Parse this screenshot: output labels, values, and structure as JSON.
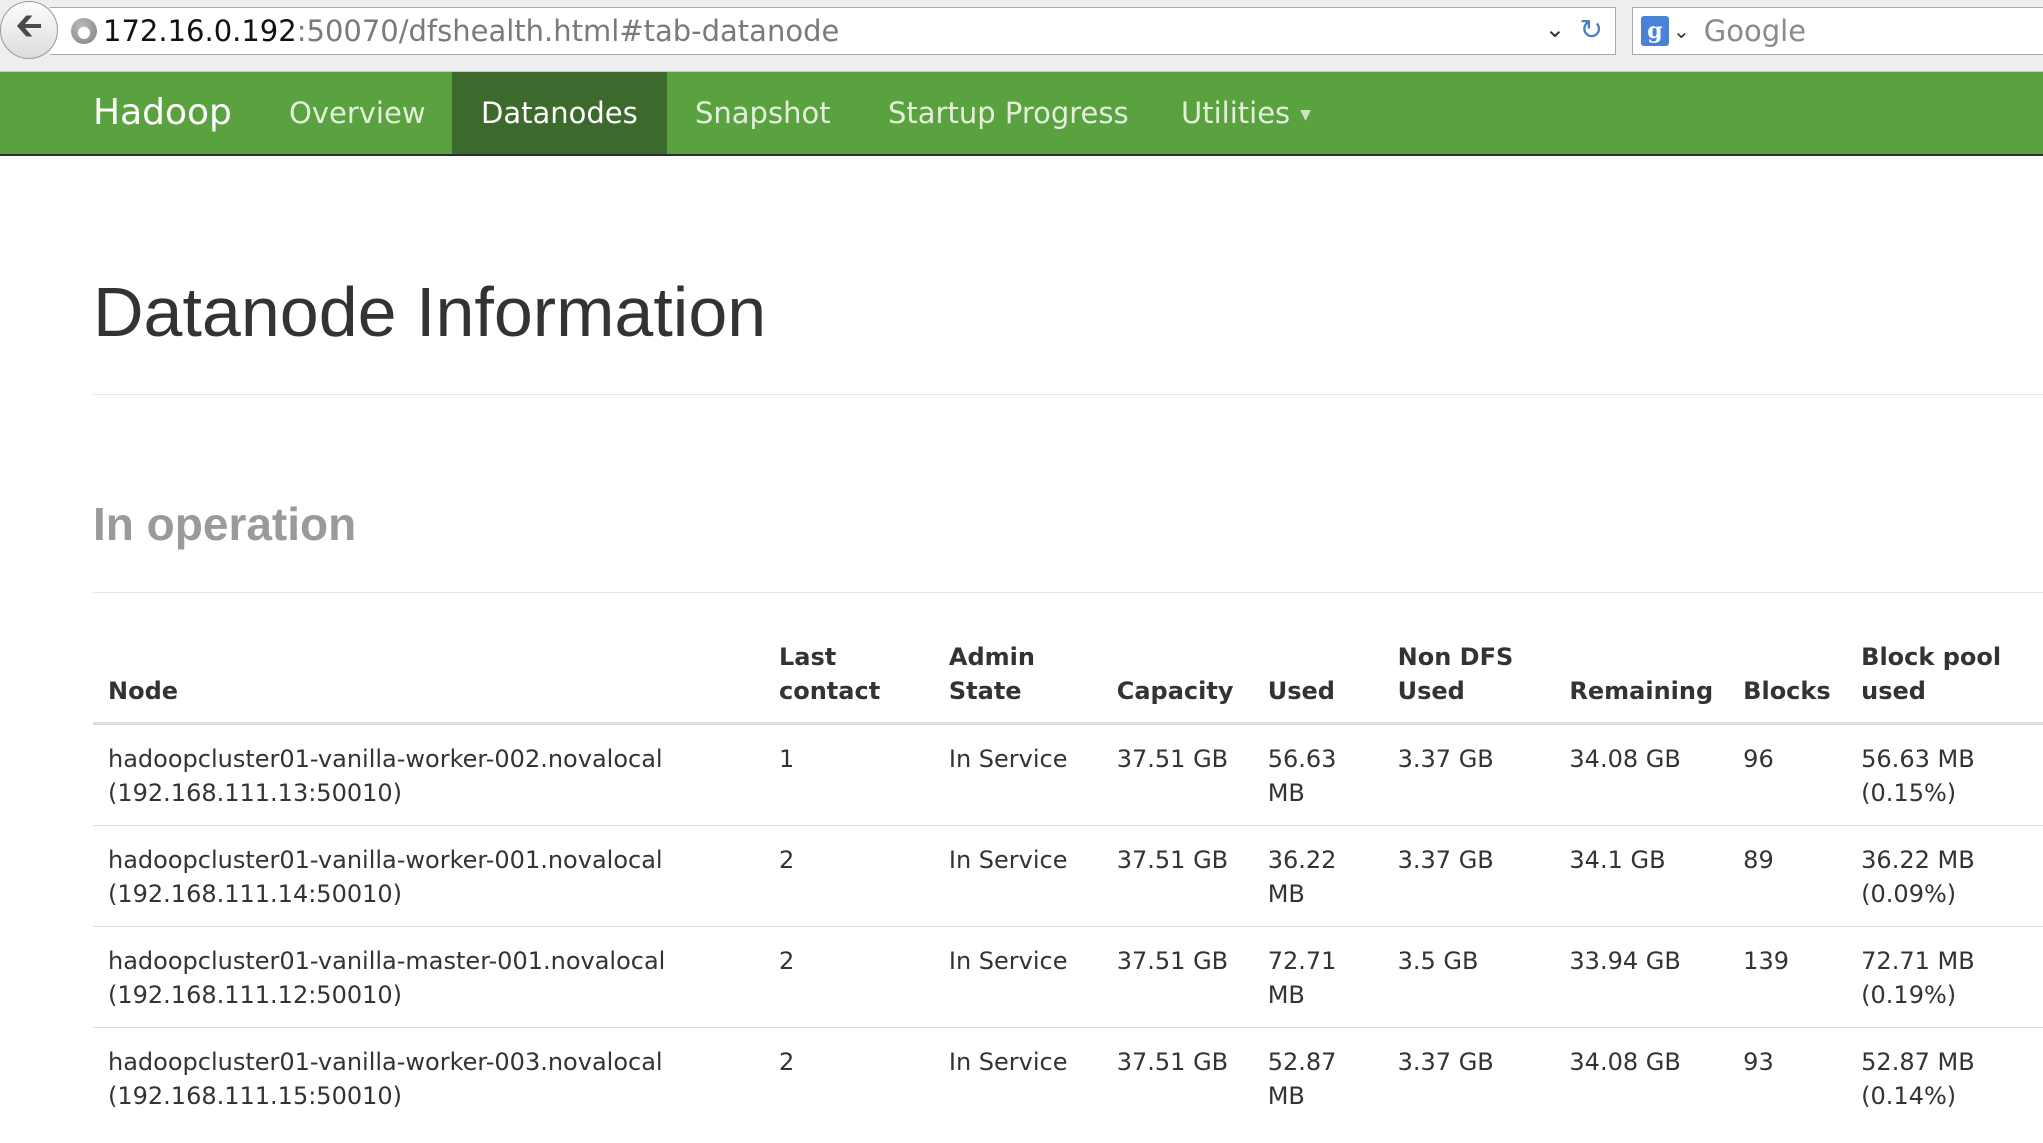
{
  "browser": {
    "url_host": "172.16.0.192",
    "url_rest": ":50070/dfshealth.html#tab-datanode",
    "search_placeholder": "Google"
  },
  "navbar": {
    "brand": "Hadoop",
    "items": [
      {
        "label": "Overview",
        "active": false
      },
      {
        "label": "Datanodes",
        "active": true
      },
      {
        "label": "Snapshot",
        "active": false
      },
      {
        "label": "Startup Progress",
        "active": false
      },
      {
        "label": "Utilities",
        "active": false
      }
    ]
  },
  "page": {
    "title": "Datanode Information",
    "section_title": "In operation"
  },
  "table": {
    "headers": {
      "node": "Node",
      "last_contact_1": "Last",
      "last_contact_2": "contact",
      "admin_state_1": "Admin",
      "admin_state_2": "State",
      "capacity": "Capacity",
      "used": "Used",
      "non_dfs_1": "Non DFS",
      "non_dfs_2": "Used",
      "remaining": "Remaining",
      "blocks": "Blocks",
      "block_pool_1": "Block pool",
      "block_pool_2": "used"
    },
    "rows": [
      {
        "node_name": "hadoopcluster01-vanilla-worker-002.novalocal",
        "node_addr": "(192.168.111.13:50010)",
        "last_contact": "1",
        "admin_state": "In Service",
        "capacity": "37.51 GB",
        "used_value": "56.63",
        "used_unit": "MB",
        "non_dfs_used": "3.37 GB",
        "remaining": "34.08 GB",
        "blocks": "96",
        "block_pool_value": "56.63 MB",
        "block_pool_pct": "(0.15%)"
      },
      {
        "node_name": "hadoopcluster01-vanilla-worker-001.novalocal",
        "node_addr": "(192.168.111.14:50010)",
        "last_contact": "2",
        "admin_state": "In Service",
        "capacity": "37.51 GB",
        "used_value": "36.22",
        "used_unit": "MB",
        "non_dfs_used": "3.37 GB",
        "remaining": "34.1 GB",
        "blocks": "89",
        "block_pool_value": "36.22 MB",
        "block_pool_pct": "(0.09%)"
      },
      {
        "node_name": "hadoopcluster01-vanilla-master-001.novalocal",
        "node_addr": "(192.168.111.12:50010)",
        "last_contact": "2",
        "admin_state": "In Service",
        "capacity": "37.51 GB",
        "used_value": "72.71",
        "used_unit": "MB",
        "non_dfs_used": "3.5 GB",
        "remaining": "33.94 GB",
        "blocks": "139",
        "block_pool_value": "72.71 MB",
        "block_pool_pct": "(0.19%)"
      },
      {
        "node_name": "hadoopcluster01-vanilla-worker-003.novalocal",
        "node_addr": "(192.168.111.15:50010)",
        "last_contact": "2",
        "admin_state": "In Service",
        "capacity": "37.51 GB",
        "used_value": "52.87",
        "used_unit": "MB",
        "non_dfs_used": "3.37 GB",
        "remaining": "34.08 GB",
        "blocks": "93",
        "block_pool_value": "52.87 MB",
        "block_pool_pct": "(0.14%)"
      }
    ]
  },
  "colors": {
    "navbar_bg": "#5aa23f",
    "navbar_active": "#3c6a2c"
  }
}
